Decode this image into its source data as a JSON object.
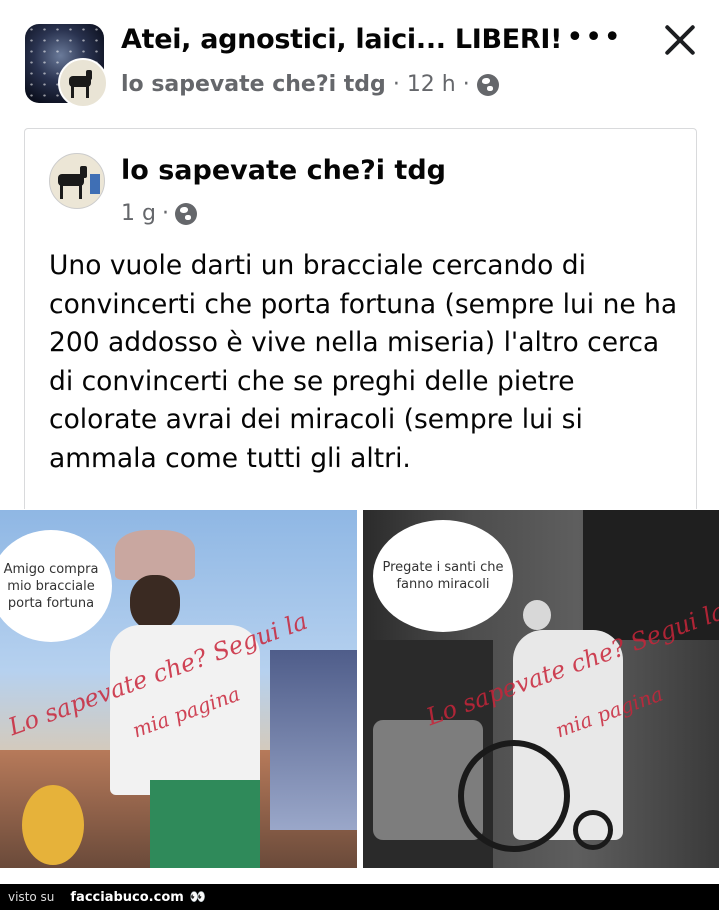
{
  "header": {
    "group_title": "Atei, agnostici, laici... LIBERI!",
    "page_name": "lo sapevate che?i tdg",
    "time": "12 h",
    "more_icon": "more-horizontal-icon",
    "close_icon": "close-icon"
  },
  "shared_post": {
    "author": "lo sapevate che?i tdg",
    "time": "1 g",
    "text": "Uno vuole darti un bracciale cercando di convincerti che porta fortuna (sempre lui ne ha 200 addosso è vive nella miseria) l'altro cerca di convincerti che se preghi delle pietre colorate avrai dei miracoli (sempre lui si ammala come tutti gli altri."
  },
  "images": {
    "left_bubble": "Amigo compra mio bracciale porta fortuna",
    "right_bubble": "Pregate i santi che fanno miracoli",
    "watermark_1": "Lo sapevate che? Segui la",
    "watermark_2": "mia pagina"
  },
  "footer": {
    "visto": "visto su",
    "site": "facciabuco.com"
  }
}
